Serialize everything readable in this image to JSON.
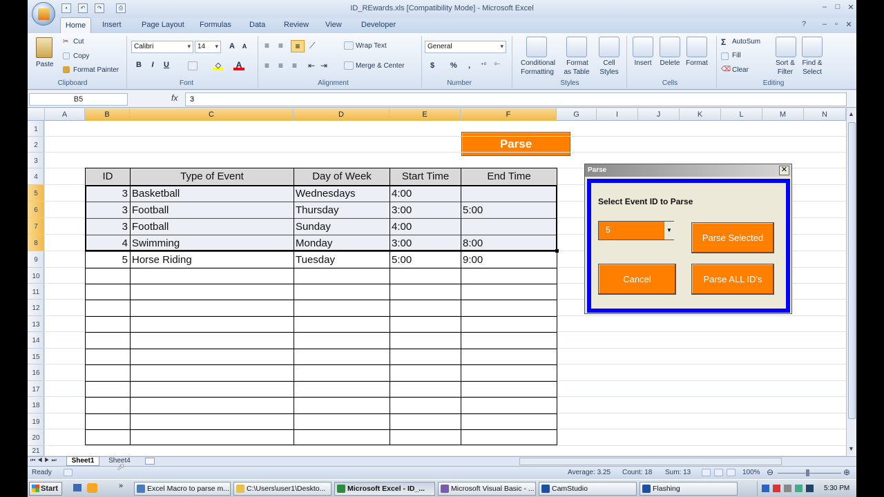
{
  "window": {
    "title": "ID_REwards.xls  [Compatibility Mode] - Microsoft Excel"
  },
  "tabs": [
    "Home",
    "Insert",
    "Page Layout",
    "Formulas",
    "Data",
    "Review",
    "View",
    "Developer"
  ],
  "ribbon": {
    "clipboard": {
      "paste": "Paste",
      "cut": "Cut",
      "copy": "Copy",
      "format_painter": "Format Painter",
      "label": "Clipboard"
    },
    "font": {
      "name": "Calibri",
      "size": "14",
      "label": "Font"
    },
    "alignment": {
      "wrap": "Wrap Text",
      "merge": "Merge & Center",
      "label": "Alignment"
    },
    "number": {
      "format": "General",
      "currency": "$",
      "percent": "%",
      "comma": ",",
      "label": "Number"
    },
    "styles": {
      "cond1": "Conditional",
      "cond2": "Formatting",
      "fmt1": "Format",
      "fmt2": "as Table",
      "cell1": "Cell",
      "cell2": "Styles",
      "label": "Styles"
    },
    "cells": {
      "insert": "Insert",
      "delete": "Delete",
      "format": "Format",
      "label": "Cells"
    },
    "editing": {
      "autosum": "AutoSum",
      "fill": "Fill",
      "clear": "Clear",
      "sort1": "Sort &",
      "sort2": "Filter",
      "find1": "Find &",
      "find2": "Select",
      "label": "Editing"
    }
  },
  "formula_bar": {
    "name_box": "B5",
    "fx": "fx",
    "value": "3"
  },
  "columns": [
    "A",
    "B",
    "C",
    "D",
    "E",
    "F",
    "G",
    "I",
    "J",
    "K",
    "L",
    "M",
    "N"
  ],
  "rows": [
    "1",
    "2",
    "3",
    "4",
    "5",
    "6",
    "7",
    "8",
    "9",
    "10",
    "11",
    "12",
    "13",
    "14",
    "15",
    "16",
    "17",
    "18",
    "19",
    "20",
    "21"
  ],
  "sheet": {
    "parse_button": "Parse",
    "headers": [
      "ID",
      "Type of Event",
      "Day of Week",
      "Start Time",
      "End Time"
    ],
    "rows": [
      [
        "3",
        "Basketball",
        "Wednesdays",
        "4:00",
        ""
      ],
      [
        "3",
        "Football",
        "Thursday",
        "3:00",
        "5:00"
      ],
      [
        "3",
        "Football",
        "Sunday",
        "4:00",
        ""
      ],
      [
        "4",
        "Swimming",
        "Monday",
        "3:00",
        "8:00"
      ],
      [
        "5",
        "Horse Riding",
        "Tuesday",
        "5:00",
        "9:00"
      ]
    ]
  },
  "sheet_tabs": [
    "Sheet1",
    "Sheet4"
  ],
  "status": {
    "ready": "Ready",
    "average": "Average: 3.25",
    "count": "Count: 18",
    "sum": "Sum: 13",
    "zoom": "100%"
  },
  "dialog": {
    "title": "Parse",
    "close": "✕",
    "prompt": "Select Event ID to Parse",
    "combo_value": "5",
    "parse_selected": "Parse Selected",
    "cancel": "Cancel",
    "parse_all": "Parse ALL ID's"
  },
  "taskbar": {
    "start": "Start",
    "items": [
      "Excel Macro to parse m...",
      "C:\\Users\\user1\\Deskto...",
      "Microsoft Excel - ID_...",
      "Microsoft Visual Basic - ...",
      "CamStudio",
      "Flashing"
    ],
    "clock": "5:30 PM"
  },
  "colors": {
    "accent_orange": "#ff8000",
    "dialog_border": "#0000ff",
    "selection": "#f1b94a"
  }
}
